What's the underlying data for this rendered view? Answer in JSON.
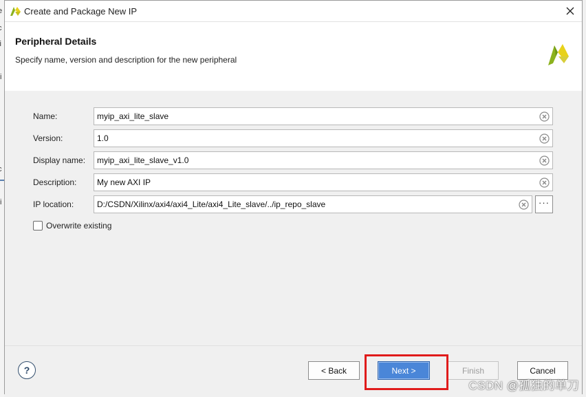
{
  "backdrop": {
    "glyphs": [
      "e",
      "c",
      "ii",
      "ti",
      "c",
      "ti"
    ]
  },
  "window": {
    "title": "Create and Package New IP",
    "icons": {
      "app": "xilinx-logo-icon",
      "close": "close-icon"
    }
  },
  "header": {
    "title": "Peripheral Details",
    "subtitle": "Specify name, version and description for the new peripheral",
    "logo_icon": "xilinx-logo-icon"
  },
  "form": {
    "name": {
      "label": "Name:",
      "value": "myip_axi_lite_slave"
    },
    "version": {
      "label": "Version:",
      "value": "1.0"
    },
    "display_name": {
      "label": "Display name:",
      "value": "myip_axi_lite_slave_v1.0"
    },
    "description": {
      "label": "Description:",
      "value": "My new AXI IP"
    },
    "ip_location": {
      "label": "IP location:",
      "value": "D:/CSDN/Xilinx/axi4/axi4_Lite/axi4_Lite_slave/../ip_repo_slave",
      "browse_label": "···"
    },
    "overwrite": {
      "label": "Overwrite existing",
      "checked": false
    }
  },
  "footer": {
    "help_label": "?",
    "back_label": "< Back",
    "next_label": "Next >",
    "finish_label": "Finish",
    "cancel_label": "Cancel"
  },
  "watermark": "CSDN @孤独的单刀",
  "colors": {
    "accent": "#4a86d8",
    "highlight": "#e01b1b",
    "xilinx_green": "#8cb21e",
    "xilinx_yellow": "#e8d21a"
  }
}
